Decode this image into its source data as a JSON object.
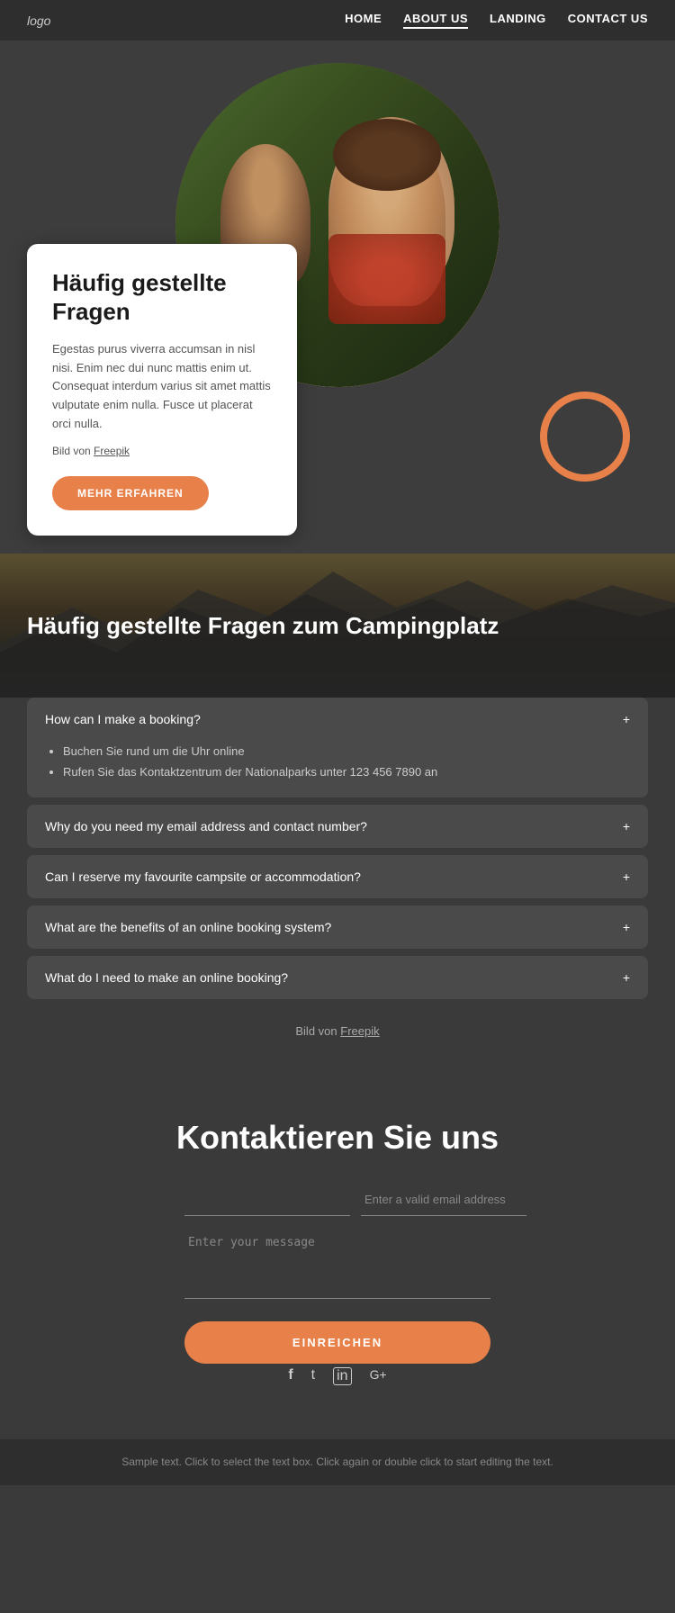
{
  "nav": {
    "logo": "logo",
    "links": [
      {
        "label": "HOME",
        "active": false
      },
      {
        "label": "ABOUT US",
        "active": true
      },
      {
        "label": "LANDING",
        "active": false
      },
      {
        "label": "CONTACT US",
        "active": false
      }
    ]
  },
  "hero": {
    "title": "Häufig gestellte Fragen",
    "body": "Egestas purus viverra accumsan in nisl nisi. Enim nec dui nunc mattis enim ut. Consequat interdum varius sit amet mattis vulputate enim nulla. Fusce ut placerat orci nulla.",
    "image_credit": "Bild von",
    "image_credit_link": "Freepik",
    "cta_button": "MEHR ERFAHREN"
  },
  "faq_banner": {
    "title": "Häufig gestellte Fragen zum Campingplatz"
  },
  "faq_items": [
    {
      "question": "How can I make a booking?",
      "open": true,
      "answers": [
        "Buchen Sie rund um die Uhr online",
        "Rufen Sie das Kontaktzentrum der Nationalparks unter 123 456 7890 an"
      ]
    },
    {
      "question": "Why do you need my email address and contact number?",
      "open": false,
      "answers": []
    },
    {
      "question": "Can I reserve my favourite campsite or accommodation?",
      "open": false,
      "answers": []
    },
    {
      "question": "What are the benefits of an online booking system?",
      "open": false,
      "answers": []
    },
    {
      "question": "What do I need to make an online booking?",
      "open": false,
      "answers": []
    }
  ],
  "freepik_caption": "Bild von",
  "freepik_link": "Freepik",
  "contact": {
    "title": "Kontaktieren Sie uns",
    "name_placeholder": "",
    "email_placeholder": "Enter a valid email address",
    "message_placeholder": "Enter your message",
    "submit_button": "EINREICHEN"
  },
  "social": {
    "icons": [
      "facebook",
      "twitter",
      "instagram",
      "googleplus"
    ]
  },
  "footer": {
    "text": "Sample text. Click to select the text box. Click again or double click to start editing the text."
  }
}
